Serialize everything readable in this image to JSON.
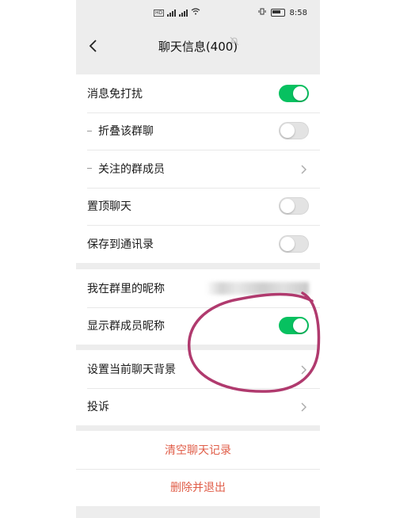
{
  "status_bar": {
    "time": "8:58"
  },
  "nav": {
    "title": "聊天信息(400)"
  },
  "settings_group_1": [
    {
      "label": "消息免打扰",
      "control": "switch",
      "on": true
    },
    {
      "label": "折叠该群聊",
      "control": "switch",
      "on": false,
      "sub": true
    },
    {
      "label": "关注的群成员",
      "control": "chevron",
      "sub": true
    },
    {
      "label": "置顶聊天",
      "control": "switch",
      "on": false
    },
    {
      "label": "保存到通讯录",
      "control": "switch",
      "on": false
    }
  ],
  "settings_group_2": [
    {
      "label": "我在群里的昵称",
      "control": "nickname"
    },
    {
      "label": "显示群成员昵称",
      "control": "switch",
      "on": true
    }
  ],
  "settings_group_3": [
    {
      "label": "设置当前聊天背景",
      "control": "chevron"
    },
    {
      "label": "投诉",
      "control": "chevron"
    }
  ],
  "actions": {
    "clear_history": "清空聊天记录",
    "delete_exit": "删除并退出"
  },
  "colors": {
    "switch_on": "#07c160",
    "danger_text": "#e05d48",
    "annotation": "#b03a6e"
  }
}
